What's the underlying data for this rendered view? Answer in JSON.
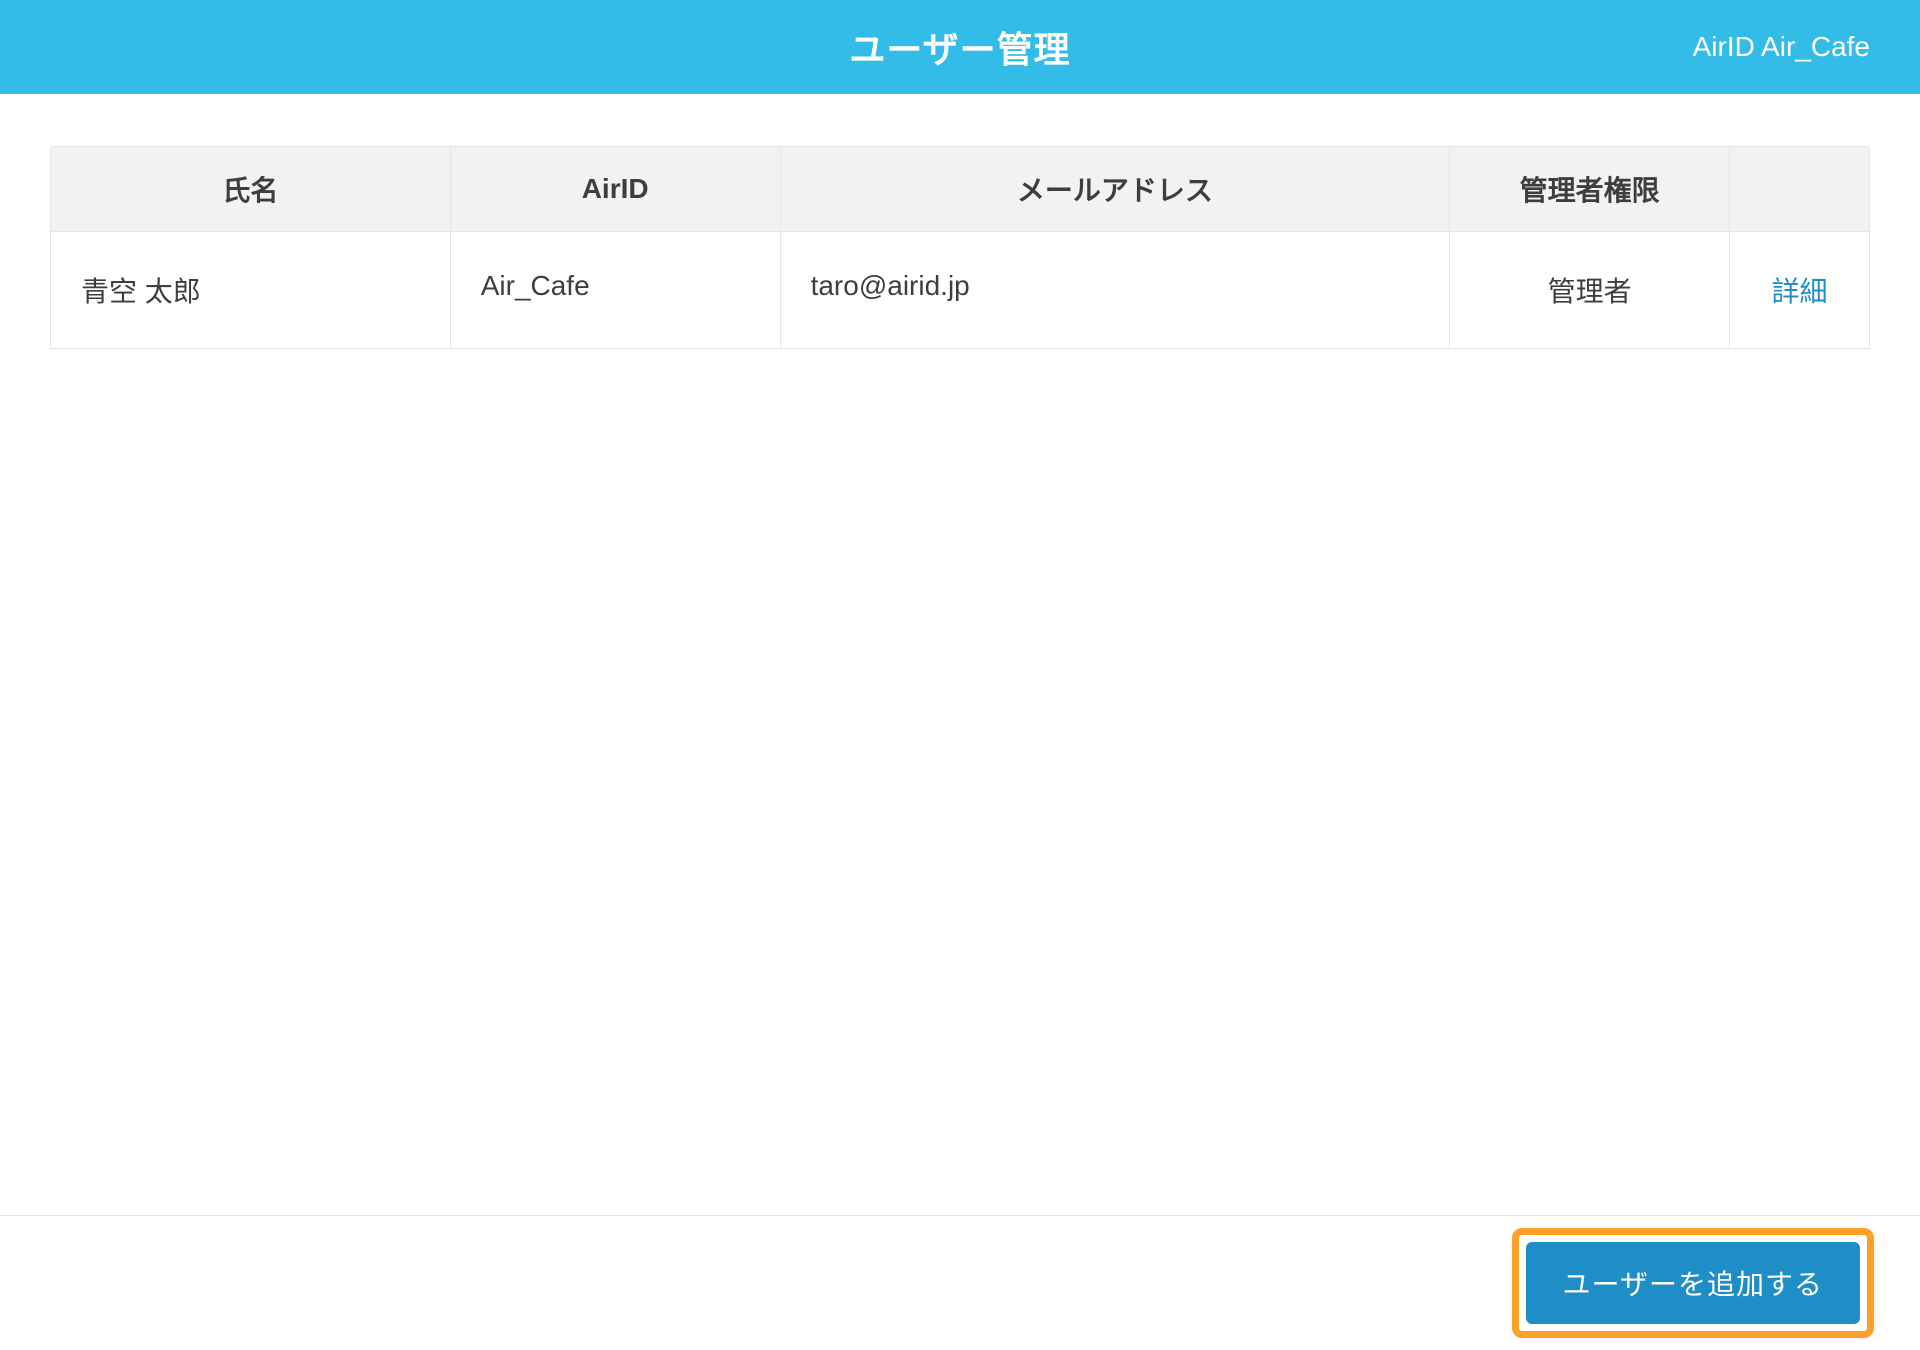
{
  "header": {
    "title": "ユーザー管理",
    "account": "AirID Air_Cafe"
  },
  "table": {
    "columns": {
      "name": "氏名",
      "airid": "AirID",
      "email": "メールアドレス",
      "role": "管理者権限",
      "action": ""
    },
    "rows": [
      {
        "name": "青空 太郎",
        "airid": "Air_Cafe",
        "email": "taro@airid.jp",
        "role": "管理者",
        "action": "詳細"
      }
    ]
  },
  "footer": {
    "add_user_label": "ユーザーを追加する"
  }
}
